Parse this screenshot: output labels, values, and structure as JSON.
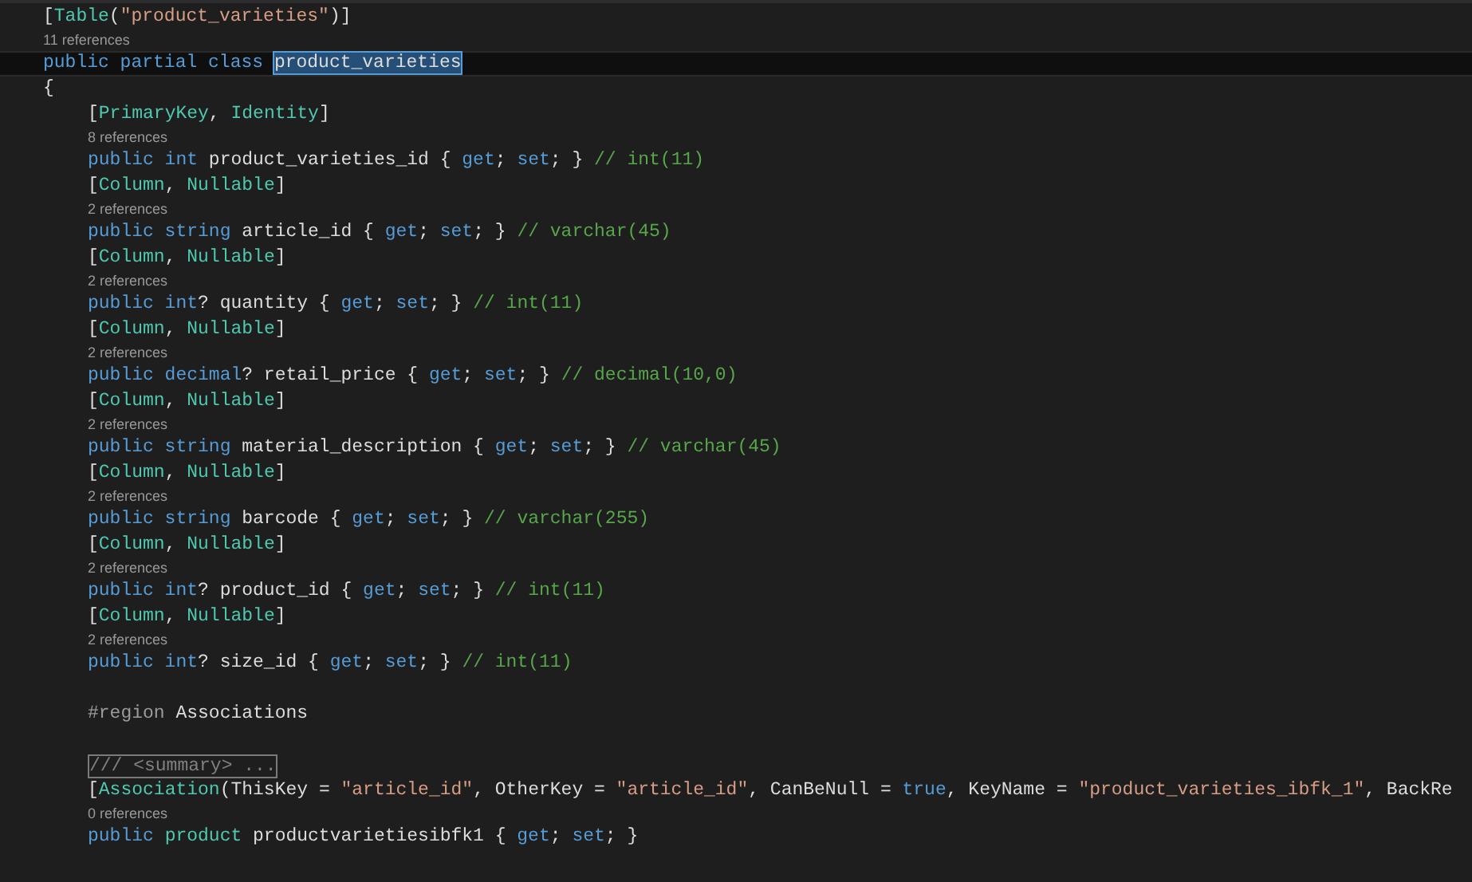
{
  "editor": {
    "lines": [
      {
        "kind": "code",
        "tokens": [
          {
            "text": "[",
            "kind": "plain"
          },
          {
            "text": "Table",
            "kind": "type"
          },
          {
            "text": "(",
            "kind": "plain"
          },
          {
            "text": "\"product_varieties\"",
            "kind": "string"
          },
          {
            "text": ")]",
            "kind": "plain"
          }
        ]
      },
      {
        "kind": "lens",
        "text": "11 references"
      },
      {
        "kind": "code",
        "current": true,
        "tokens": [
          {
            "text": "public partial class ",
            "kind": "keyword",
            "selected": false
          },
          {
            "text": "product_varieties",
            "kind": "plain",
            "selected": true
          }
        ]
      },
      {
        "kind": "code",
        "tokens": [
          {
            "text": "{",
            "kind": "plain"
          }
        ],
        "children": [
          {
            "kind": "code",
            "tokens": [
              {
                "text": "[",
                "kind": "plain"
              },
              {
                "text": "PrimaryKey",
                "kind": "type"
              },
              {
                "text": ", ",
                "kind": "plain"
              },
              {
                "text": "Identity",
                "kind": "type"
              },
              {
                "text": "]",
                "kind": "plain"
              }
            ]
          },
          {
            "kind": "lens",
            "text": "8 references"
          },
          {
            "kind": "code",
            "tokens": [
              {
                "text": "public int ",
                "kind": "keyword"
              },
              {
                "text": "product_varieties_id { ",
                "kind": "plain"
              },
              {
                "text": "get",
                "kind": "keyword"
              },
              {
                "text": "; ",
                "kind": "plain"
              },
              {
                "text": "set",
                "kind": "keyword"
              },
              {
                "text": "; } ",
                "kind": "plain"
              },
              {
                "text": "// int(11)",
                "kind": "comment"
              }
            ]
          },
          {
            "kind": "code",
            "tokens": [
              {
                "text": "[",
                "kind": "plain"
              },
              {
                "text": "Column",
                "kind": "type"
              },
              {
                "text": ", ",
                "kind": "plain"
              },
              {
                "text": "Nullable",
                "kind": "type"
              },
              {
                "text": "]",
                "kind": "plain"
              }
            ]
          },
          {
            "kind": "lens",
            "text": "2 references"
          },
          {
            "kind": "code",
            "tokens": [
              {
                "text": "public string ",
                "kind": "keyword"
              },
              {
                "text": "article_id { ",
                "kind": "plain"
              },
              {
                "text": "get",
                "kind": "keyword"
              },
              {
                "text": "; ",
                "kind": "plain"
              },
              {
                "text": "set",
                "kind": "keyword"
              },
              {
                "text": "; } ",
                "kind": "plain"
              },
              {
                "text": "// varchar(45)",
                "kind": "comment"
              }
            ]
          },
          {
            "kind": "code",
            "tokens": [
              {
                "text": "[",
                "kind": "plain"
              },
              {
                "text": "Column",
                "kind": "type"
              },
              {
                "text": ", ",
                "kind": "plain"
              },
              {
                "text": "Nullable",
                "kind": "type"
              },
              {
                "text": "]",
                "kind": "plain"
              }
            ]
          },
          {
            "kind": "lens",
            "text": "2 references"
          },
          {
            "kind": "code",
            "tokens": [
              {
                "text": "public int",
                "kind": "keyword"
              },
              {
                "text": "? quantity { ",
                "kind": "plain"
              },
              {
                "text": "get",
                "kind": "keyword"
              },
              {
                "text": "; ",
                "kind": "plain"
              },
              {
                "text": "set",
                "kind": "keyword"
              },
              {
                "text": "; } ",
                "kind": "plain"
              },
              {
                "text": "// int(11)",
                "kind": "comment"
              }
            ]
          },
          {
            "kind": "code",
            "tokens": [
              {
                "text": "[",
                "kind": "plain"
              },
              {
                "text": "Column",
                "kind": "type"
              },
              {
                "text": ", ",
                "kind": "plain"
              },
              {
                "text": "Nullable",
                "kind": "type"
              },
              {
                "text": "]",
                "kind": "plain"
              }
            ]
          },
          {
            "kind": "lens",
            "text": "2 references"
          },
          {
            "kind": "code",
            "tokens": [
              {
                "text": "public decimal",
                "kind": "keyword"
              },
              {
                "text": "? retail_price { ",
                "kind": "plain"
              },
              {
                "text": "get",
                "kind": "keyword"
              },
              {
                "text": "; ",
                "kind": "plain"
              },
              {
                "text": "set",
                "kind": "keyword"
              },
              {
                "text": "; } ",
                "kind": "plain"
              },
              {
                "text": "// decimal(10,0)",
                "kind": "comment"
              }
            ]
          },
          {
            "kind": "code",
            "tokens": [
              {
                "text": "[",
                "kind": "plain"
              },
              {
                "text": "Column",
                "kind": "type"
              },
              {
                "text": ", ",
                "kind": "plain"
              },
              {
                "text": "Nullable",
                "kind": "type"
              },
              {
                "text": "]",
                "kind": "plain"
              }
            ]
          },
          {
            "kind": "lens",
            "text": "2 references"
          },
          {
            "kind": "code",
            "tokens": [
              {
                "text": "public string ",
                "kind": "keyword"
              },
              {
                "text": "material_description { ",
                "kind": "plain"
              },
              {
                "text": "get",
                "kind": "keyword"
              },
              {
                "text": "; ",
                "kind": "plain"
              },
              {
                "text": "set",
                "kind": "keyword"
              },
              {
                "text": "; } ",
                "kind": "plain"
              },
              {
                "text": "// varchar(45)",
                "kind": "comment"
              }
            ]
          },
          {
            "kind": "code",
            "tokens": [
              {
                "text": "[",
                "kind": "plain"
              },
              {
                "text": "Column",
                "kind": "type"
              },
              {
                "text": ", ",
                "kind": "plain"
              },
              {
                "text": "Nullable",
                "kind": "type"
              },
              {
                "text": "]",
                "kind": "plain"
              }
            ]
          },
          {
            "kind": "lens",
            "text": "2 references"
          },
          {
            "kind": "code",
            "tokens": [
              {
                "text": "public string ",
                "kind": "keyword"
              },
              {
                "text": "barcode { ",
                "kind": "plain"
              },
              {
                "text": "get",
                "kind": "keyword"
              },
              {
                "text": "; ",
                "kind": "plain"
              },
              {
                "text": "set",
                "kind": "keyword"
              },
              {
                "text": "; } ",
                "kind": "plain"
              },
              {
                "text": "// varchar(255)",
                "kind": "comment"
              }
            ]
          },
          {
            "kind": "code",
            "tokens": [
              {
                "text": "[",
                "kind": "plain"
              },
              {
                "text": "Column",
                "kind": "type"
              },
              {
                "text": ", ",
                "kind": "plain"
              },
              {
                "text": "Nullable",
                "kind": "type"
              },
              {
                "text": "]",
                "kind": "plain"
              }
            ]
          },
          {
            "kind": "lens",
            "text": "2 references"
          },
          {
            "kind": "code",
            "tokens": [
              {
                "text": "public int",
                "kind": "keyword"
              },
              {
                "text": "? product_id { ",
                "kind": "plain"
              },
              {
                "text": "get",
                "kind": "keyword"
              },
              {
                "text": "; ",
                "kind": "plain"
              },
              {
                "text": "set",
                "kind": "keyword"
              },
              {
                "text": "; } ",
                "kind": "plain"
              },
              {
                "text": "// int(11)",
                "kind": "comment"
              }
            ]
          },
          {
            "kind": "code",
            "tokens": [
              {
                "text": "[",
                "kind": "plain"
              },
              {
                "text": "Column",
                "kind": "type"
              },
              {
                "text": ", ",
                "kind": "plain"
              },
              {
                "text": "Nullable",
                "kind": "type"
              },
              {
                "text": "]",
                "kind": "plain"
              }
            ]
          },
          {
            "kind": "lens",
            "text": "2 references"
          },
          {
            "kind": "code",
            "tokens": [
              {
                "text": "public int",
                "kind": "keyword"
              },
              {
                "text": "? size_id { ",
                "kind": "plain"
              },
              {
                "text": "get",
                "kind": "keyword"
              },
              {
                "text": "; ",
                "kind": "plain"
              },
              {
                "text": "set",
                "kind": "keyword"
              },
              {
                "text": "; } ",
                "kind": "plain"
              },
              {
                "text": "// int(11)",
                "kind": "comment"
              }
            ]
          },
          {
            "kind": "blank"
          },
          {
            "kind": "code",
            "tokens": [
              {
                "text": "#region",
                "kind": "directive"
              },
              {
                "text": " Associations",
                "kind": "plain"
              }
            ]
          },
          {
            "kind": "blank"
          },
          {
            "kind": "collapsed",
            "text": "/// <summary> ..."
          },
          {
            "kind": "code",
            "tokens": [
              {
                "text": "[",
                "kind": "plain"
              },
              {
                "text": "Association",
                "kind": "type"
              },
              {
                "text": "(ThisKey = ",
                "kind": "plain"
              },
              {
                "text": "\"article_id\"",
                "kind": "string"
              },
              {
                "text": ", OtherKey = ",
                "kind": "plain"
              },
              {
                "text": "\"article_id\"",
                "kind": "string"
              },
              {
                "text": ", CanBeNull = ",
                "kind": "plain"
              },
              {
                "text": "true",
                "kind": "keyword"
              },
              {
                "text": ", KeyName = ",
                "kind": "plain"
              },
              {
                "text": "\"product_varieties_ibfk_1\"",
                "kind": "string"
              },
              {
                "text": ", BackRe",
                "kind": "plain"
              }
            ]
          },
          {
            "kind": "lens",
            "text": "0 references"
          },
          {
            "kind": "code",
            "tokens": [
              {
                "text": "public ",
                "kind": "keyword"
              },
              {
                "text": "product",
                "kind": "type"
              },
              {
                "text": " productvarietiesibfk1 { ",
                "kind": "plain"
              },
              {
                "text": "get",
                "kind": "keyword"
              },
              {
                "text": "; ",
                "kind": "plain"
              },
              {
                "text": "set",
                "kind": "keyword"
              },
              {
                "text": "; }",
                "kind": "plain"
              }
            ]
          }
        ]
      }
    ]
  }
}
